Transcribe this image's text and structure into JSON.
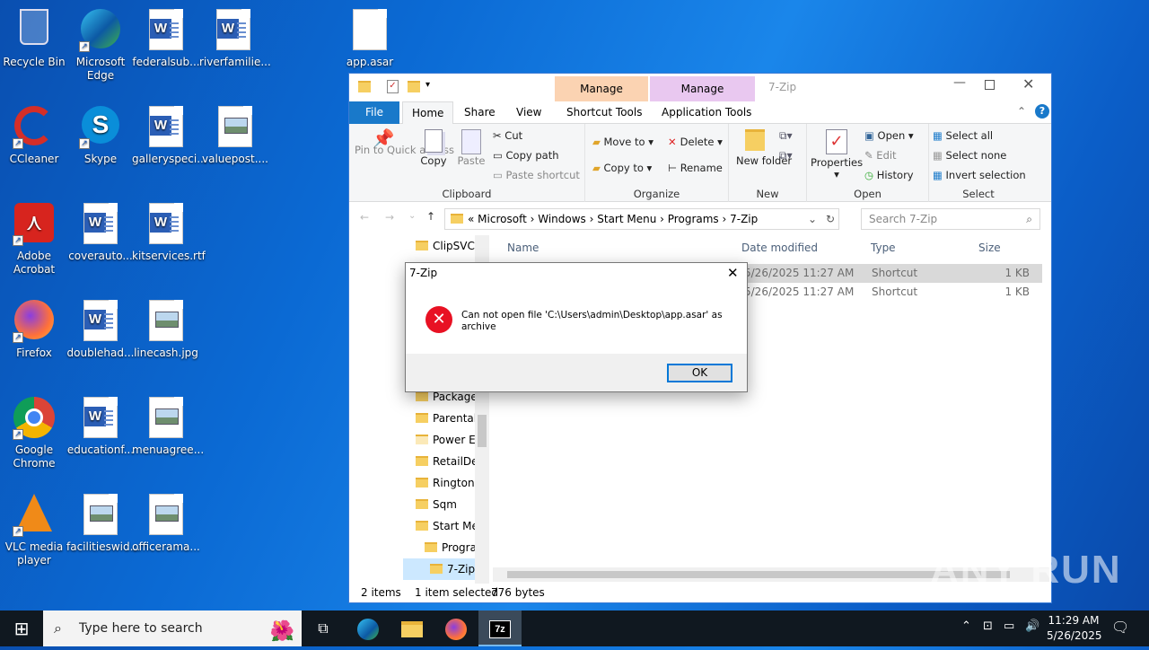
{
  "desktop_icons": [
    {
      "label": "Recycle Bin",
      "icon": "recycle-bin-icon"
    },
    {
      "label": "Microsoft Edge",
      "icon": "edge-icon"
    },
    {
      "label": "federalsub...",
      "icon": "word-doc-icon"
    },
    {
      "label": "riverfamilie...",
      "icon": "word-doc-icon"
    },
    {
      "label": "app.asar",
      "icon": "blank-file-icon"
    },
    {
      "label": "CCleaner",
      "icon": "ccleaner-icon"
    },
    {
      "label": "Skype",
      "icon": "skype-icon"
    },
    {
      "label": "galleryspeci...",
      "icon": "word-doc-icon"
    },
    {
      "label": "valuepost....",
      "icon": "image-file-icon"
    },
    {
      "label": "Adobe Acrobat",
      "icon": "acrobat-icon"
    },
    {
      "label": "coverauto...",
      "icon": "word-doc-icon"
    },
    {
      "label": "kitservices.rtf",
      "icon": "word-doc-icon"
    },
    {
      "label": "Firefox",
      "icon": "firefox-icon"
    },
    {
      "label": "doublehad...",
      "icon": "word-doc-icon"
    },
    {
      "label": "linecash.jpg",
      "icon": "image-file-icon"
    },
    {
      "label": "Google Chrome",
      "icon": "chrome-icon"
    },
    {
      "label": "educationf...",
      "icon": "word-doc-icon"
    },
    {
      "label": "menuagree...",
      "icon": "image-file-icon"
    },
    {
      "label": "VLC media player",
      "icon": "vlc-icon"
    },
    {
      "label": "facilitieswid...",
      "icon": "image-file-icon"
    },
    {
      "label": "officerama...",
      "icon": "image-file-icon"
    }
  ],
  "explorer": {
    "title": "7-Zip",
    "ctx_manage_1": "Manage",
    "ctx_manage_2": "Manage",
    "tabs": {
      "file": "File",
      "home": "Home",
      "share": "Share",
      "view": "View",
      "shortcut_tools": "Shortcut Tools",
      "application_tools": "Application Tools"
    },
    "ribbon": {
      "pin": "Pin to Quick access",
      "copy": "Copy",
      "paste": "Paste",
      "cut": "Cut",
      "copy_path": "Copy path",
      "paste_shortcut": "Paste shortcut",
      "clipboard": "Clipboard",
      "move_to": "Move to",
      "copy_to": "Copy to",
      "delete": "Delete",
      "rename": "Rename",
      "organize": "Organize",
      "new_folder": "New folder",
      "new": "New",
      "properties": "Properties",
      "open": "Open",
      "edit": "Edit",
      "history": "History",
      "open_group": "Open",
      "select_all": "Select all",
      "select_none": "Select none",
      "invert": "Invert selection",
      "select_group": "Select"
    },
    "address": {
      "sep": "«",
      "crumbs": [
        "Microsoft",
        "Windows",
        "Start Menu",
        "Programs",
        "7-Zip"
      ],
      "search_placeholder": "Search 7-Zip"
    },
    "nav": [
      "ClipSVC",
      "Package",
      "Parental",
      "Power Ef",
      "RetailDer",
      "Ringtone",
      "Sqm",
      "Start Mer",
      "Prograr",
      "7-Zip"
    ],
    "columns": {
      "name": "Name",
      "date": "Date modified",
      "type": "Type",
      "size": "Size"
    },
    "rows": [
      {
        "date": "5/26/2025 11:27 AM",
        "type": "Shortcut",
        "size": "1 KB"
      },
      {
        "date": "5/26/2025 11:27 AM",
        "type": "Shortcut",
        "size": "1 KB"
      }
    ],
    "status": {
      "items": "2 items",
      "selected": "1 item selected",
      "bytes": "776 bytes"
    }
  },
  "dialog": {
    "title": "7-Zip",
    "message": "Can not open file 'C:\\Users\\admin\\Desktop\\app.asar' as archive",
    "ok": "OK"
  },
  "taskbar": {
    "search_placeholder": "Type here to search",
    "time": "11:29 AM",
    "date": "5/26/2025"
  },
  "watermark": "ANY RUN"
}
